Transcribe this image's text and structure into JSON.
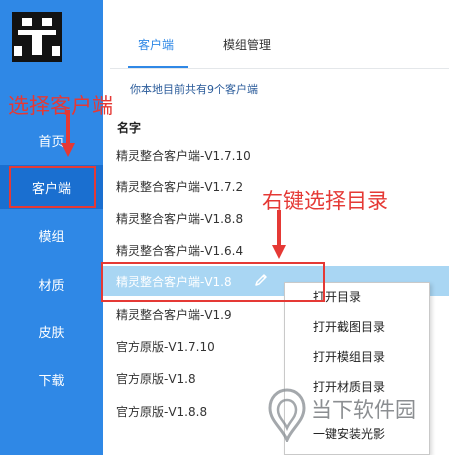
{
  "sidebar": {
    "items": [
      {
        "label": "首页"
      },
      {
        "label": "客户端"
      },
      {
        "label": "模组"
      },
      {
        "label": "材质"
      },
      {
        "label": "皮肤"
      },
      {
        "label": "下载"
      }
    ]
  },
  "annotations": {
    "left": "选择客户端",
    "right": "右键选择目录",
    "color": "#e53935"
  },
  "tabs": [
    {
      "label": "客户端"
    },
    {
      "label": "模组管理"
    }
  ],
  "count_text": "你本地目前共有9个客户端",
  "column_header": "名字",
  "clients": [
    {
      "name": "精灵整合客户端-V1.7.10"
    },
    {
      "name": "精灵整合客户端-V1.7.2"
    },
    {
      "name": "精灵整合客户端-V1.8.8"
    },
    {
      "name": "精灵整合客户端-V1.6.4"
    },
    {
      "name": "精灵整合客户端-V1.8"
    },
    {
      "name": "精灵整合客户端-V1.9"
    },
    {
      "name": "官方原版-V1.7.10"
    },
    {
      "name": "官方原版-V1.8"
    },
    {
      "name": "官方原版-V1.8.8"
    }
  ],
  "context_menu": {
    "items": [
      {
        "label": "打开目录"
      },
      {
        "label": "打开截图目录"
      },
      {
        "label": "打开模组目录"
      },
      {
        "label": "打开材质目录"
      },
      {
        "label": "一键安装光影"
      }
    ]
  },
  "watermark": {
    "text": "当下软件园"
  },
  "colors": {
    "accent": "#2f88e6",
    "selected_row": "#a9d6f3",
    "sidebar_active": "#1a6fd0"
  }
}
